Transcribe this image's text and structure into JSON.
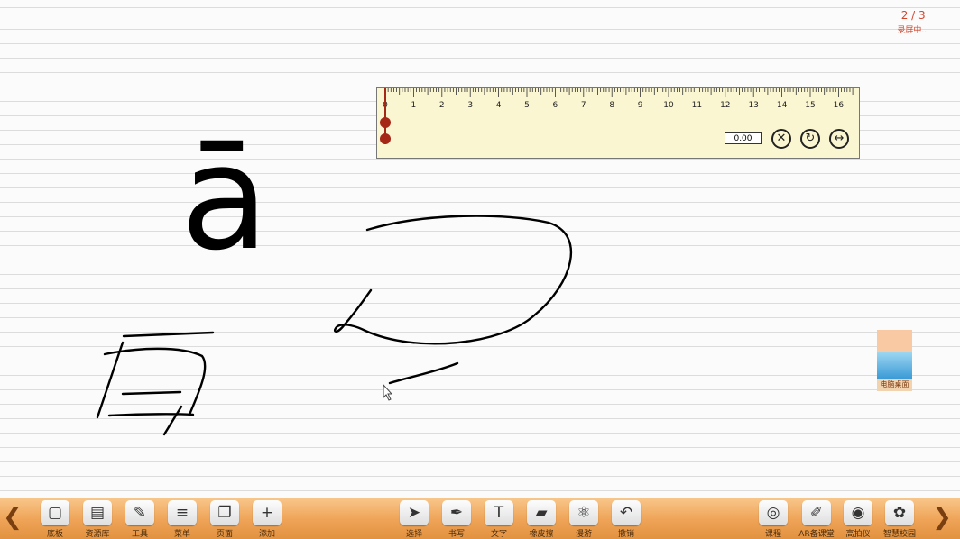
{
  "page_indicator": {
    "current": "2 / 3",
    "status": "录屏中..."
  },
  "ruler": {
    "numbers": [
      "0",
      "1",
      "2",
      "3",
      "4",
      "5",
      "6",
      "7",
      "8",
      "9",
      "10",
      "11",
      "12",
      "13",
      "14",
      "15",
      "16"
    ],
    "value": "0.00",
    "icons": [
      "close-circle-icon",
      "rotate-icon",
      "flip-horizontal-icon"
    ]
  },
  "board": {
    "vowel": "ā"
  },
  "desktop_widget": {
    "label": "电脑桌面"
  },
  "taskbar": {
    "prev_glyph": "❮",
    "next_glyph": "❯",
    "items": [
      {
        "label": "底板",
        "icon": "square-icon",
        "glyph": "▢"
      },
      {
        "label": "资源库",
        "icon": "cabinet-icon",
        "glyph": "▤"
      },
      {
        "label": "工具",
        "icon": "tools-icon",
        "glyph": "✎"
      },
      {
        "label": "菜单",
        "icon": "menu-icon",
        "glyph": "≡"
      },
      {
        "label": "页面",
        "icon": "pages-icon",
        "glyph": "❐"
      },
      {
        "label": "添加",
        "icon": "plus-icon",
        "glyph": "+"
      },
      {
        "label": "选择",
        "icon": "cursor-icon",
        "glyph": "➤"
      },
      {
        "label": "书写",
        "icon": "pen-icon",
        "glyph": "✒"
      },
      {
        "label": "文字",
        "icon": "text-icon",
        "glyph": "T"
      },
      {
        "label": "橡皮擦",
        "icon": "eraser-icon",
        "glyph": "▰"
      },
      {
        "label": "漫游",
        "icon": "atom-icon",
        "glyph": "⚛"
      },
      {
        "label": "撤销",
        "icon": "undo-icon",
        "glyph": "↶"
      },
      {
        "label": "课程",
        "icon": "binoculars-icon",
        "glyph": "◎"
      },
      {
        "label": "AR备课堂",
        "icon": "ar-icon",
        "glyph": "✐"
      },
      {
        "label": "高拍仪",
        "icon": "webcam-icon",
        "glyph": "◉"
      },
      {
        "label": "智慧校园",
        "icon": "campus-icon",
        "glyph": "✿"
      }
    ]
  }
}
